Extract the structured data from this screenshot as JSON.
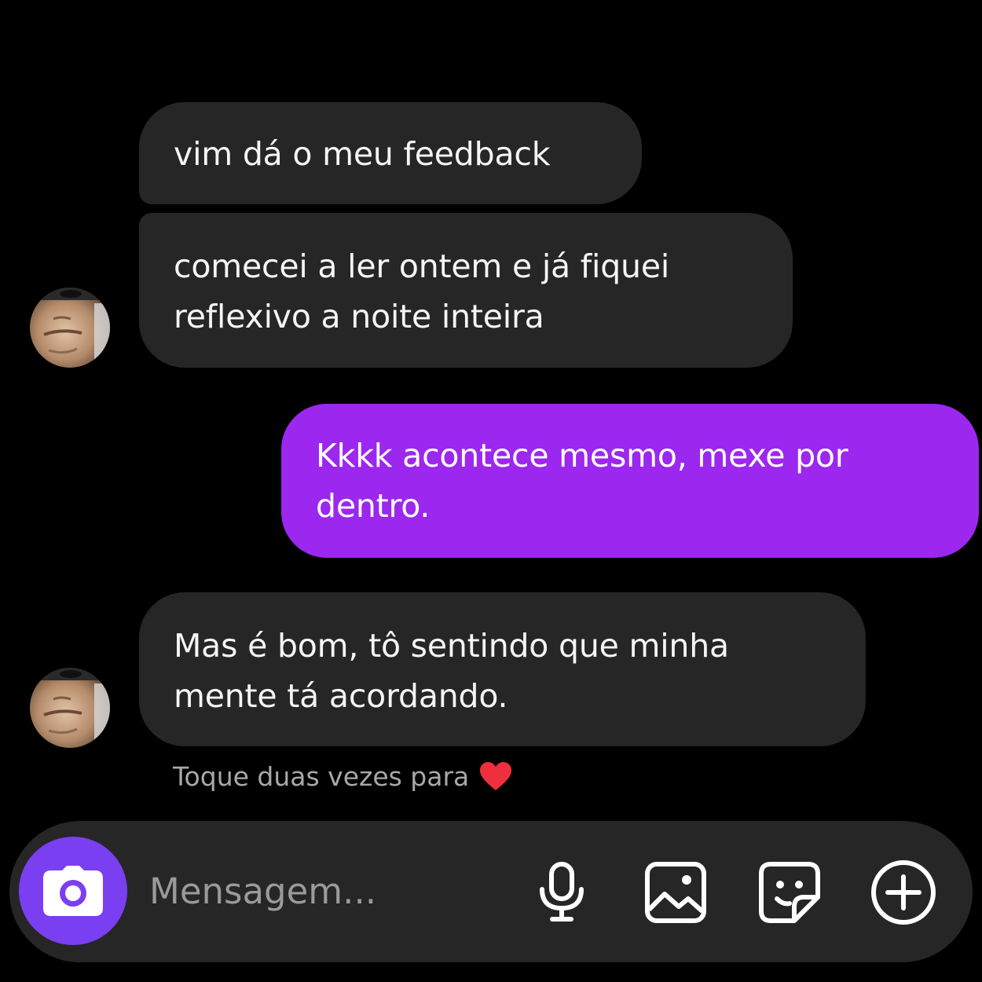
{
  "colors": {
    "background": "#000000",
    "incoming_bubble": "#262626",
    "outgoing_bubble": "#9c27ef",
    "camera_button": "#7b3ff2",
    "hint_text": "#a8a8a8",
    "heart": "#ed2f3e"
  },
  "messages": [
    {
      "direction": "incoming",
      "lines": [
        "vim dá o meu feedback"
      ]
    },
    {
      "direction": "incoming",
      "lines": [
        "comecei a ler ontem e já fiquei",
        "reflexivo a noite inteira"
      ]
    },
    {
      "direction": "outgoing",
      "lines": [
        "Kkkk acontece mesmo, mexe por",
        "dentro."
      ]
    },
    {
      "direction": "incoming",
      "lines": [
        "Mas é bom, tô sentindo que minha",
        "mente tá acordando."
      ]
    }
  ],
  "hint": {
    "text": "Toque duas vezes para",
    "icon": "heart-icon"
  },
  "composer": {
    "placeholder": "Mensagem...",
    "icons": [
      "camera-icon",
      "microphone-icon",
      "gallery-icon",
      "sticker-icon",
      "plus-icon"
    ]
  }
}
